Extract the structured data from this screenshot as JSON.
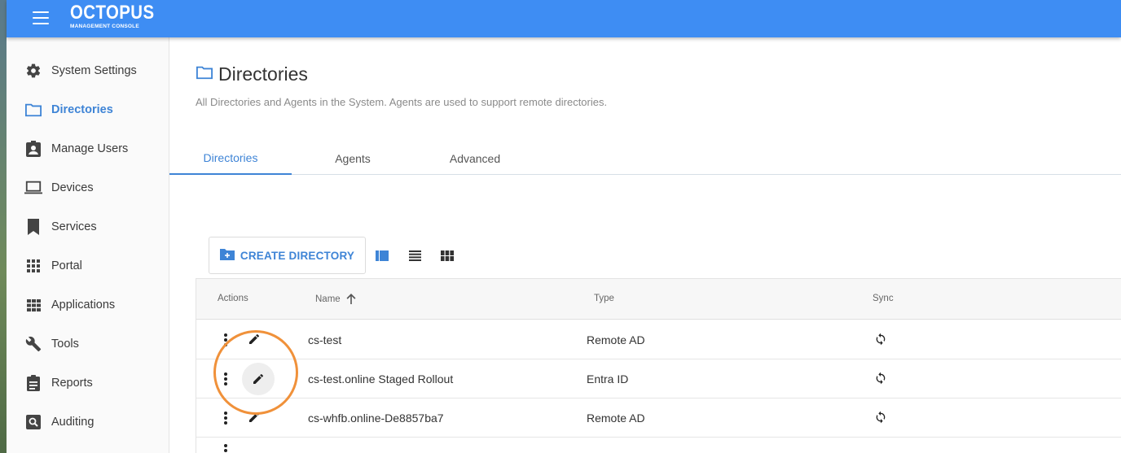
{
  "app": {
    "brand_name": "OCTOPUS",
    "brand_subtitle": "MANAGEMENT CONSOLE",
    "accent_color": "#3e8df3",
    "highlight_color": "#f0913a"
  },
  "sidebar": {
    "items": [
      {
        "label": "System Settings",
        "icon": "gear-icon",
        "active": false
      },
      {
        "label": "Directories",
        "icon": "folder-icon",
        "active": true
      },
      {
        "label": "Manage Users",
        "icon": "user-badge-icon",
        "active": false
      },
      {
        "label": "Devices",
        "icon": "laptop-icon",
        "active": false
      },
      {
        "label": "Services",
        "icon": "bookmark-icon",
        "active": false
      },
      {
        "label": "Portal",
        "icon": "grid-icon",
        "active": false
      },
      {
        "label": "Applications",
        "icon": "apps-icon",
        "active": false
      },
      {
        "label": "Tools",
        "icon": "wrench-icon",
        "active": false
      },
      {
        "label": "Reports",
        "icon": "clipboard-icon",
        "active": false
      },
      {
        "label": "Auditing",
        "icon": "search-box-icon",
        "active": false
      }
    ]
  },
  "page": {
    "title": "Directories",
    "subtitle": "All Directories and Agents in the System. Agents are used to support remote directories."
  },
  "tabs": [
    {
      "label": "Directories",
      "active": true
    },
    {
      "label": "Agents",
      "active": false
    },
    {
      "label": "Advanced",
      "active": false
    }
  ],
  "toolbar": {
    "create_label": "CREATE DIRECTORY",
    "view_modes": [
      "split-view-icon",
      "list-view-icon",
      "grid-view-icon"
    ]
  },
  "table": {
    "columns": {
      "actions": "Actions",
      "name": "Name",
      "type": "Type",
      "sync": "Sync"
    },
    "sort": {
      "column": "name",
      "direction": "ascending"
    },
    "rows": [
      {
        "name": "cs-test",
        "type": "Remote AD"
      },
      {
        "name": "cs-test.online Staged Rollout",
        "type": "Entra ID"
      },
      {
        "name": "cs-whfb.online-De8857ba7",
        "type": "Remote AD"
      }
    ]
  }
}
